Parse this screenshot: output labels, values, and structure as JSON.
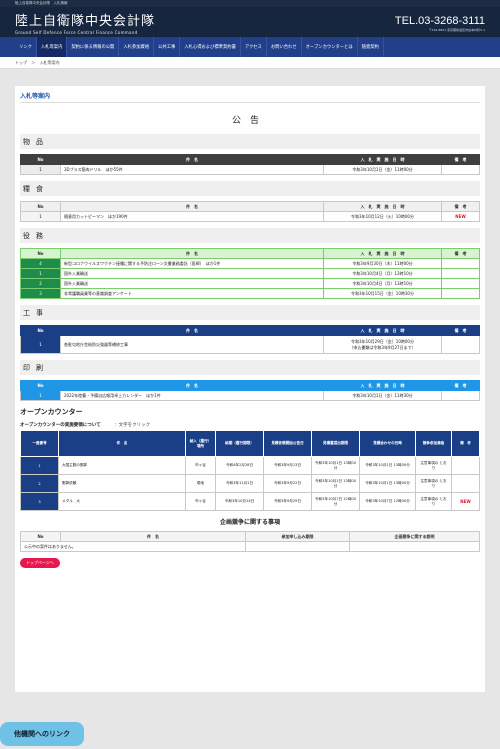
{
  "site": {
    "top_strip": "陸上自衛隊中央会計隊　入札情報",
    "brand_jp": "陸上自衛隊中央会計隊",
    "brand_en": "Ground Self Defence Force Central Finance Command",
    "tel": "TEL.03-3268-3111",
    "address": "〒162-8801 東京都新宿区市谷本村町5-1"
  },
  "nav": {
    "items": [
      {
        "label": "リンク"
      },
      {
        "label": "入札等案内"
      },
      {
        "label": "契約に係る情報の公開"
      },
      {
        "label": "入札参加資格"
      },
      {
        "label": "公共工事"
      },
      {
        "label": "入札心得および標準契約書"
      },
      {
        "label": "アクセス"
      },
      {
        "label": "お問い合わせ"
      },
      {
        "label": "オープンカウンターとは"
      },
      {
        "label": "随意契約"
      }
    ]
  },
  "breadcrumb": {
    "home": "トップ",
    "sep": "＞",
    "current": "入札等案内"
  },
  "page": {
    "title": "入札等案内",
    "notice": "公告"
  },
  "sections": {
    "goods": {
      "heading": "物品",
      "headers": {
        "no": "No",
        "name": "件　名",
        "date": "入　札　実　施　日　時",
        "note": "備　考"
      },
      "rows": [
        {
          "no": "1",
          "name": "3Dプラス筋肉ドリル　ほか55件",
          "date": "令和3年10月1日（金）11時00分",
          "note": ""
        }
      ]
    },
    "food": {
      "heading": "糧食",
      "headers": {
        "no": "No",
        "name": "件　名",
        "date": "入　札　実　施　日　時",
        "note": "備　考"
      },
      "rows": [
        {
          "no": "1",
          "name": "随意用カットピーマン　ほか190件",
          "date": "令和3年10月12日（火）10時00分",
          "note": "NEW"
        }
      ]
    },
    "services": {
      "heading": "役務",
      "headers": {
        "no": "No",
        "name": "件　名",
        "date": "入　札　実　施　日　時",
        "note": "備　考"
      },
      "rows": [
        {
          "no": "4",
          "name": "新型コロナウイルスワクチン接種に関する予防注ローン文書業務委託（医師）　ほか1件",
          "date": "令和3年9月30日（木）11時00分",
          "note": ""
        },
        {
          "no": "1",
          "name": "国外入業輸送",
          "date": "令和3年10月4日（月）13時10分",
          "note": ""
        },
        {
          "no": "2",
          "name": "国外入業輸送",
          "date": "令和3年10月4日（月）13時10分",
          "note": ""
        },
        {
          "no": "3",
          "name": "非常護職員業等の意識調査アンケート",
          "date": "令和3年10月15日（金）10時30分",
          "note": ""
        }
      ]
    },
    "construction": {
      "heading": "工事",
      "headers": {
        "no": "No",
        "name": "件　名",
        "date": "入　札　実　施　日　時",
        "note": "備　考"
      },
      "rows": [
        {
          "no": "1",
          "name": "各駐屯地庁舎給防災強器等補修工事",
          "date": "令和3年10月29日（金）10時00分",
          "date2": "（申込書類は令和3年9月27日まで）",
          "note": ""
        }
      ]
    },
    "printing": {
      "heading": "印刷",
      "headers": {
        "no": "No",
        "name": "件　名",
        "date": "入　札　実　施　日　時",
        "note": "備　考"
      },
      "rows": [
        {
          "no": "1",
          "name": "2022年陸曹・予備自広報用卓上カレンダー　ほか1件",
          "date": "令和3年10月1日（金）11時30分",
          "note": ""
        }
      ]
    }
  },
  "open_counter": {
    "title": "オープンカウンター",
    "subtitle": "オープンカウンターの実施要領について",
    "hint": "：文字をクリック",
    "headers": [
      "一連番号",
      "件　名",
      "納入（履行）場所",
      "納期（履行期限）",
      "見積依頼開始公告日",
      "見積書提出期限",
      "見積合わせの日時",
      "競争参加資格",
      "備　考"
    ],
    "rows": [
      {
        "no": "1",
        "name": "大国主郵の郵郭",
        "place": "市ヶ谷",
        "due": "令和4年2月28日",
        "notice": "令和3年9月13日",
        "deadline": "令和3年10月1日 13時00分",
        "meeting": "令和3年10月1日 13時00分",
        "qual": "注意事項の とおり",
        "note": ""
      },
      {
        "no": "2",
        "name": "郵郭依頼",
        "place": "現地",
        "due": "令和3年11月1日",
        "notice": "令和3年9月22日",
        "deadline": "令和3年10月1日 13時00分",
        "meeting": "令和3年10月1日 13時00分",
        "qual": "注意事項の とおり",
        "note": ""
      },
      {
        "no": "3",
        "name": "メダル　大",
        "place": "市ヶ谷",
        "due": "令和3年10月14日",
        "notice": "令和3年9月29日",
        "deadline": "令和3年10月7日 12時00分",
        "meeting": "令和3年10月7日 12時00分",
        "qual": "注意事項の とおり",
        "note": "NEW"
      }
    ]
  },
  "competition": {
    "title": "企画競争に関する事項",
    "headers": {
      "no": "No",
      "name": "件　名",
      "apply": "参加申し込み期限",
      "brief": "企画競争に関する説明"
    },
    "empty": "公示中の案件はありません。"
  },
  "buttons": {
    "to_top": "トップページへ",
    "links": "他機関へのリンク"
  }
}
